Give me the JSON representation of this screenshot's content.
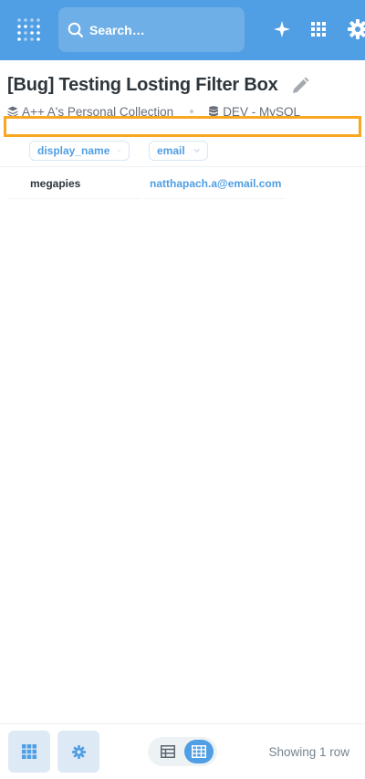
{
  "topbar": {
    "search_placeholder": "Search…",
    "bg_color": "#509ee3",
    "icons": [
      "metabase-logo-icon",
      "search-icon",
      "sparkle-icon",
      "grid-apps-icon",
      "gear-icon"
    ]
  },
  "header": {
    "title": "[Bug] Testing Losting Filter Box",
    "collection": "A++ A's Personal Collection",
    "database": "DEV - MySQL"
  },
  "table": {
    "columns": [
      {
        "label": "display_name"
      },
      {
        "label": "email"
      }
    ],
    "rows": [
      {
        "display_name": "megapies",
        "email": "natthapach.a@email.com"
      }
    ]
  },
  "footer": {
    "row_count": "Showing 1 row"
  },
  "colors": {
    "brand": "#509ee3",
    "highlight": "#f9a620",
    "text": "#2e353b",
    "muted": "#696e7b"
  }
}
